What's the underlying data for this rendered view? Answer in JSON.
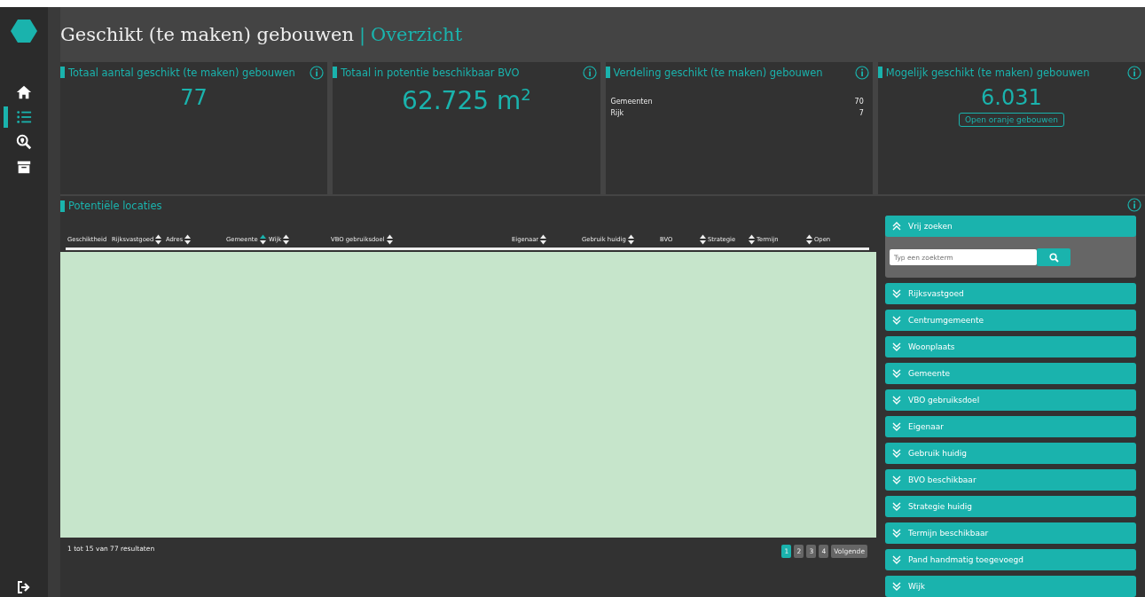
{
  "header": {
    "title": "Geschikt (te maken) gebouwen",
    "separator": "|",
    "subtitle": "Overzicht"
  },
  "nav": {
    "items": [
      {
        "kind": "home",
        "selected": false
      },
      {
        "kind": "list",
        "selected": true
      },
      {
        "kind": "map-search",
        "selected": false
      },
      {
        "kind": "archive",
        "selected": false
      }
    ]
  },
  "cards": [
    {
      "kind": "number",
      "title": "Totaal aantal geschikt (te maken) gebouwen",
      "value": "77"
    },
    {
      "kind": "area",
      "title": "Totaal in potentie beschikbaar BVO",
      "value": "62.725 m$^{2}$"
    },
    {
      "kind": "list",
      "title": "Verdeling geschikt (te maken) gebouwen",
      "rows": [
        {
          "label": "Gemeenten",
          "value": "70"
        },
        {
          "label": "Rijk",
          "value": "7"
        }
      ]
    },
    {
      "kind": "number-button",
      "title": "Mogelijk geschikt (te maken) gebouwen",
      "value": "6.031",
      "button": "Open oranje gebouwen"
    }
  ],
  "locations": {
    "title": "Potentiële locaties",
    "columns": [
      {
        "label": "Geschiktheid",
        "kind": "plain"
      },
      {
        "label": "Rijksvastgoed",
        "kind": "sortafter",
        "sorted_asc": false
      },
      {
        "label": "Adres",
        "kind": "sortafter",
        "sorted_asc": false
      },
      {
        "label": "Gemeente",
        "kind": "sortafter",
        "sorted_asc": true
      },
      {
        "label": "Wijk",
        "kind": "sortafter",
        "sorted_asc": false
      },
      {
        "label": "VBO gebruiksdoel",
        "kind": "sortafter",
        "sorted_asc": false
      },
      {
        "label": "Eigenaar",
        "kind": "sortafter",
        "sorted_asc": false
      },
      {
        "label": "Gebruik huidig",
        "kind": "sortafter",
        "sorted_asc": false
      },
      {
        "label": "BVO",
        "kind": "plain"
      },
      {
        "label": "Strategie",
        "kind": "sortbefore",
        "sorted_asc": false
      },
      {
        "label": "Termijn",
        "kind": "sortbefore",
        "sorted_asc": false
      },
      {
        "label": "Open",
        "kind": "sortbefore",
        "sorted_asc": false
      }
    ],
    "results": "1 tot 15 van 77 resultaten",
    "pages": [
      {
        "label": "1",
        "selected": true
      },
      {
        "label": "2",
        "selected": false
      },
      {
        "label": "3",
        "selected": false
      },
      {
        "label": "4",
        "selected": false
      }
    ],
    "next": "Volgende"
  },
  "filters": [
    {
      "label": "Vrij zoeken",
      "expanded": true,
      "placeholder": "Typ een zoekterm"
    },
    {
      "label": "Rijksvastgoed",
      "expanded": false
    },
    {
      "label": "Centrumgemeente",
      "expanded": false
    },
    {
      "label": "Woonplaats",
      "expanded": false
    },
    {
      "label": "Gemeente",
      "expanded": false
    },
    {
      "label": "VBO gebruiksdoel",
      "expanded": false
    },
    {
      "label": "Eigenaar",
      "expanded": false
    },
    {
      "label": "Gebruik huidig",
      "expanded": false
    },
    {
      "label": "BVO beschikbaar",
      "expanded": false
    },
    {
      "label": "Strategie huidig",
      "expanded": false
    },
    {
      "label": "Termijn beschikbaar",
      "expanded": false
    },
    {
      "label": "Pand handmatig toegevoegd",
      "expanded": false
    },
    {
      "label": "Wijk",
      "expanded": false
    }
  ]
}
